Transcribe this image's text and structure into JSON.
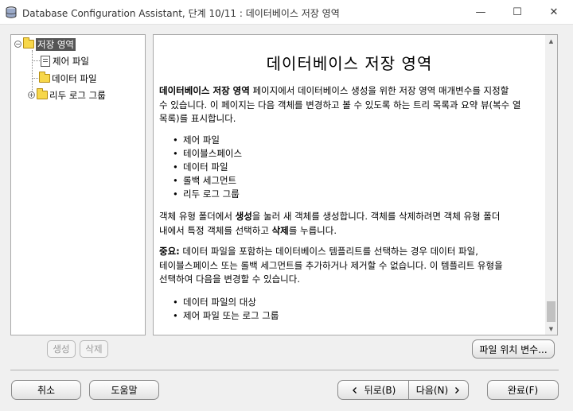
{
  "window": {
    "title": "Database Configuration Assistant, 단계 10/11 : 데이터베이스 저장 영역",
    "minimize_glyph": "—",
    "maximize_glyph": "☐",
    "close_glyph": "✕"
  },
  "tree": {
    "root": {
      "label": "저장 영역",
      "expander": "−"
    },
    "children": [
      {
        "label": "제어 파일",
        "icon": "control-file-icon"
      },
      {
        "label": "데이터 파일",
        "icon": "folder-icon"
      },
      {
        "label": "리두 로그 그룹",
        "icon": "folder-icon",
        "expander": "+"
      }
    ]
  },
  "content": {
    "title": "데이터베이스 저장 영역",
    "intro_bold": "데이터베이스 저장 영역",
    "intro_line1_rest": " 페이지에서 데이터베이스 생성을 위한 저장 영역 매개변수를 지정할",
    "intro_line2": "수 있습니다. 이 페이지는 다음 객체를 변경하고 볼 수 있도록 하는 트리 목록과 요약 뷰(복수 열",
    "intro_line3": "목록)를 표시합니다.",
    "objects": [
      "제어 파일",
      "테이블스페이스",
      "데이터 파일",
      "롤백 세그먼트",
      "리두 로그 그룹"
    ],
    "create_line1_a": "객체 유형 폴더에서 ",
    "create_bold": "생성",
    "create_line1_b": "을 눌러 새 객체를 생성합니다. 객체를 삭제하려면 객체 유형 폴더",
    "create_line2_a": "내에서 특정 객체를 선택하고 ",
    "delete_bold": "삭제",
    "create_line2_b": "를 누릅니다.",
    "note_label": "중요:",
    "note_line1_rest": " 데이터 파일을 포함하는 데이터베이스 템플리트를 선택하는 경우 데이터 파일,",
    "note_line2": "테이블스페이스 또는 롤백 세그먼트를 추가하거나 제거할 수 없습니다. 이 템플리트 유형을",
    "note_line3": "선택하여 다음을 변경할 수 있습니다.",
    "changeable": [
      "데이터 파일의 대상",
      "제어 파일 또는 로그 그룹"
    ]
  },
  "buttons": {
    "create": "생성",
    "delete": "삭제",
    "file_location_vars": "파일 위치 변수...",
    "cancel": "취소",
    "help": "도움말",
    "back": "뒤로(B)",
    "next": "다음(N)",
    "finish": "완료(F)"
  },
  "icons": {
    "back": "chevron-left-icon",
    "next": "chevron-right-icon"
  },
  "colors": {
    "folder": "#f7d74a",
    "selection": "#555555"
  }
}
